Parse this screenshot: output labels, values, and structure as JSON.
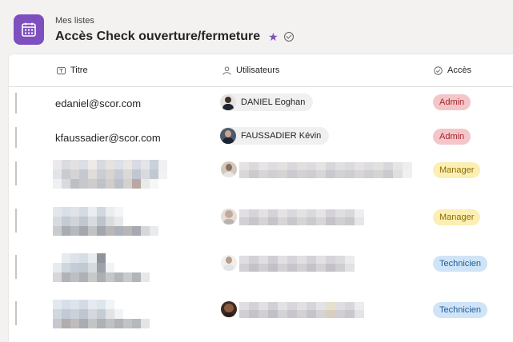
{
  "header": {
    "breadcrumb": "Mes listes",
    "title": "Accès Check ouverture/fermeture",
    "app_icon": "calendar-icon",
    "favorite_icon": "star-icon",
    "status_icon": "check-circle-icon"
  },
  "columns": {
    "titre": "Titre",
    "utilisateurs": "Utilisateurs",
    "acces": "Accès"
  },
  "rows": [
    {
      "email": "edaniel@scor.com",
      "user": "DANIEL Eoghan",
      "access": "Admin"
    },
    {
      "email": "kfaussadier@scor.com",
      "user": "FAUSSADIER Kévin",
      "access": "Admin"
    },
    {
      "email": "",
      "user": "",
      "access": "Manager"
    },
    {
      "email": "",
      "user": "",
      "access": "Manager"
    },
    {
      "email": "",
      "user": "",
      "access": "Technicien"
    },
    {
      "email": "",
      "user": "",
      "access": "Technicien"
    }
  ],
  "colors": {
    "accent": "#7e4fbf",
    "admin_bg": "#f4c6c9",
    "admin_fg": "#a4262c",
    "manager_bg": "#fcefb4",
    "manager_fg": "#8a6d00",
    "technicien_bg": "#d0e4f7",
    "technicien_fg": "#1f5c99"
  }
}
